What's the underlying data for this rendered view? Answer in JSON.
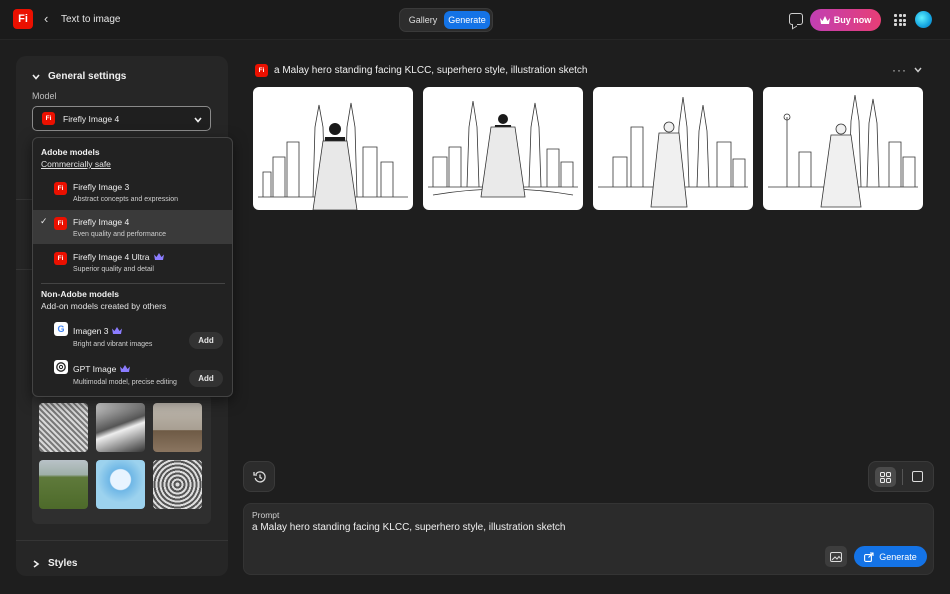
{
  "header": {
    "logo_text": "Fi",
    "title": "Text to image",
    "tabs": [
      {
        "label": "Gallery",
        "active": false
      },
      {
        "label": "Generate",
        "active": true
      }
    ],
    "buy_label": "Buy now",
    "icons": [
      "chevron-left-icon",
      "chat-icon",
      "crown-icon",
      "apps-grid-icon",
      "avatar"
    ]
  },
  "sidebar": {
    "section_title": "General settings",
    "model_label": "Model",
    "model_badge": "Fi",
    "model_value": "Firefly Image 4",
    "styles_title": "Styles"
  },
  "dropdown": {
    "adobe_heading": "Adobe models",
    "adobe_sub": "Commercially safe",
    "adobe_items": [
      {
        "badge": "Fi",
        "name": "Firefly Image 3",
        "desc": "Abstract concepts and expression",
        "selected": false,
        "premium": false
      },
      {
        "badge": "Fi",
        "name": "Firefly Image 4",
        "desc": "Even quality and performance",
        "selected": true,
        "premium": false
      },
      {
        "badge": "Fi",
        "name": "Firefly Image 4 Ultra",
        "desc": "Superior quality and detail",
        "selected": false,
        "premium": true
      }
    ],
    "partner_heading": "Non-Adobe models",
    "partner_sub": "Add-on models created by others",
    "partner_items": [
      {
        "icon": "G",
        "name": "Imagen 3",
        "desc": "Bright and vibrant images",
        "action": "Add",
        "premium": true
      },
      {
        "icon": "gpt",
        "name": "GPT Image",
        "desc": "Multimodal model, precise editing",
        "action": "Add",
        "premium": true
      }
    ]
  },
  "results": {
    "badge": "Fi",
    "prompt": "a Malay hero standing facing KLCC, superhero style, illustration sketch",
    "more_icon": "more-horizontal-icon",
    "collapse_icon": "chevron-down-icon",
    "image_count": 4
  },
  "prompt_box": {
    "label": "Prompt",
    "value": "a Malay hero standing facing KLCC, superhero style, illustration sketch",
    "generate_label": "Generate"
  },
  "colors": {
    "accent": "#1473e6",
    "brand": "#eb1000",
    "premium": "#8b7cff",
    "buy_gradient": [
      "#c13fb3",
      "#e73e76"
    ]
  }
}
